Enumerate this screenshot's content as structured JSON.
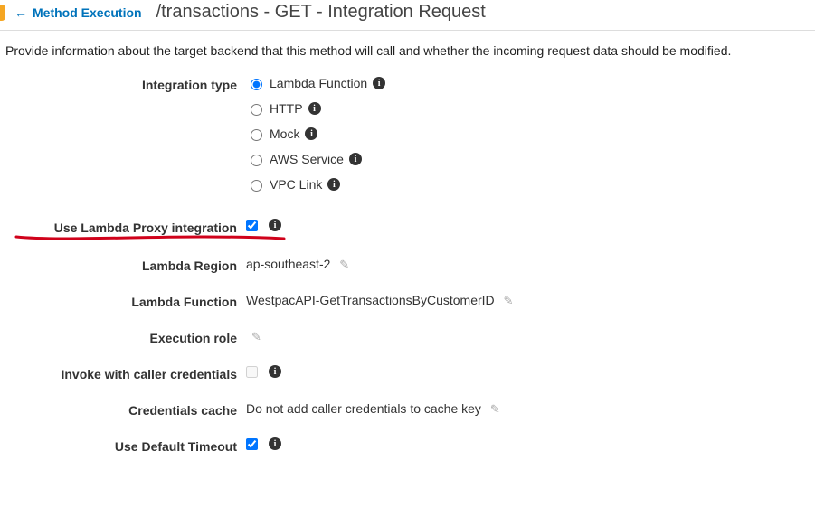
{
  "header": {
    "back_label": "Method Execution",
    "title": "/transactions - GET - Integration Request"
  },
  "description": "Provide information about the target backend that this method will call and whether the incoming request data should be modified.",
  "form": {
    "integration_type": {
      "label": "Integration type",
      "options": {
        "lambda": "Lambda Function",
        "http": "HTTP",
        "mock": "Mock",
        "aws_service": "AWS Service",
        "vpc_link": "VPC Link"
      },
      "selected": "lambda"
    },
    "use_lambda_proxy": {
      "label": "Use Lambda Proxy integration",
      "checked": true
    },
    "lambda_region": {
      "label": "Lambda Region",
      "value": "ap-southeast-2"
    },
    "lambda_function": {
      "label": "Lambda Function",
      "value": "WestpacAPI-GetTransactionsByCustomerID"
    },
    "execution_role": {
      "label": "Execution role",
      "value": ""
    },
    "invoke_caller": {
      "label": "Invoke with caller credentials",
      "checked": false
    },
    "credentials_cache": {
      "label": "Credentials cache",
      "value": "Do not add caller credentials to cache key"
    },
    "use_default_timeout": {
      "label": "Use Default Timeout",
      "checked": true
    }
  }
}
